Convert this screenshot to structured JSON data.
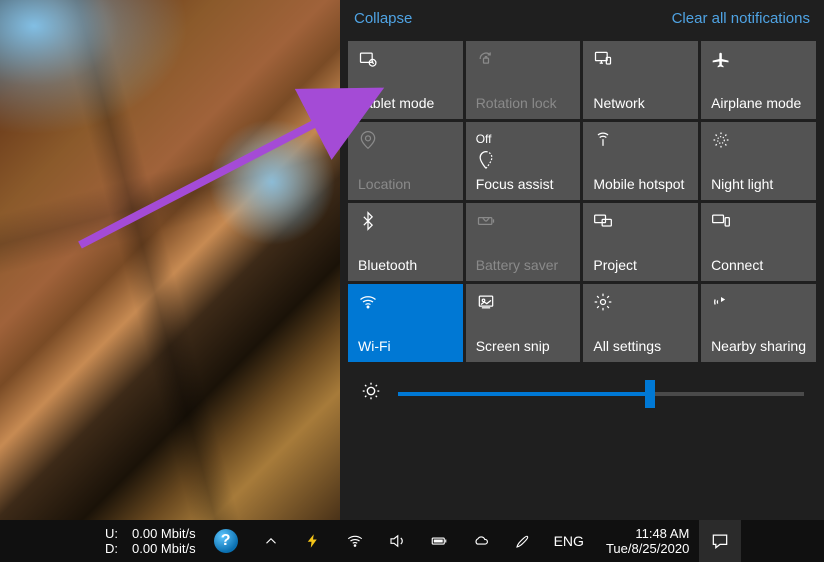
{
  "header": {
    "collapse": "Collapse",
    "clear": "Clear all notifications"
  },
  "tiles": {
    "tablet_mode": "Tablet mode",
    "rotation_lock": "Rotation lock",
    "network": "Network",
    "airplane_mode": "Airplane mode",
    "location": "Location",
    "focus_assist": "Focus assist",
    "focus_assist_state": "Off",
    "mobile_hotspot": "Mobile hotspot",
    "night_light": "Night light",
    "bluetooth": "Bluetooth",
    "battery_saver": "Battery saver",
    "project": "Project",
    "connect": "Connect",
    "wifi": "Wi-Fi",
    "screen_snip": "Screen snip",
    "all_settings": "All settings",
    "nearby_sharing": "Nearby sharing"
  },
  "brightness": {
    "percent": 62
  },
  "taskbar": {
    "net_u_label": "U:",
    "net_d_label": "D:",
    "net_u_value": "0.00 Mbit/s",
    "net_d_value": "0.00 Mbit/s",
    "lang": "ENG",
    "time": "11:48 AM",
    "date": "Tue/8/25/2020"
  }
}
